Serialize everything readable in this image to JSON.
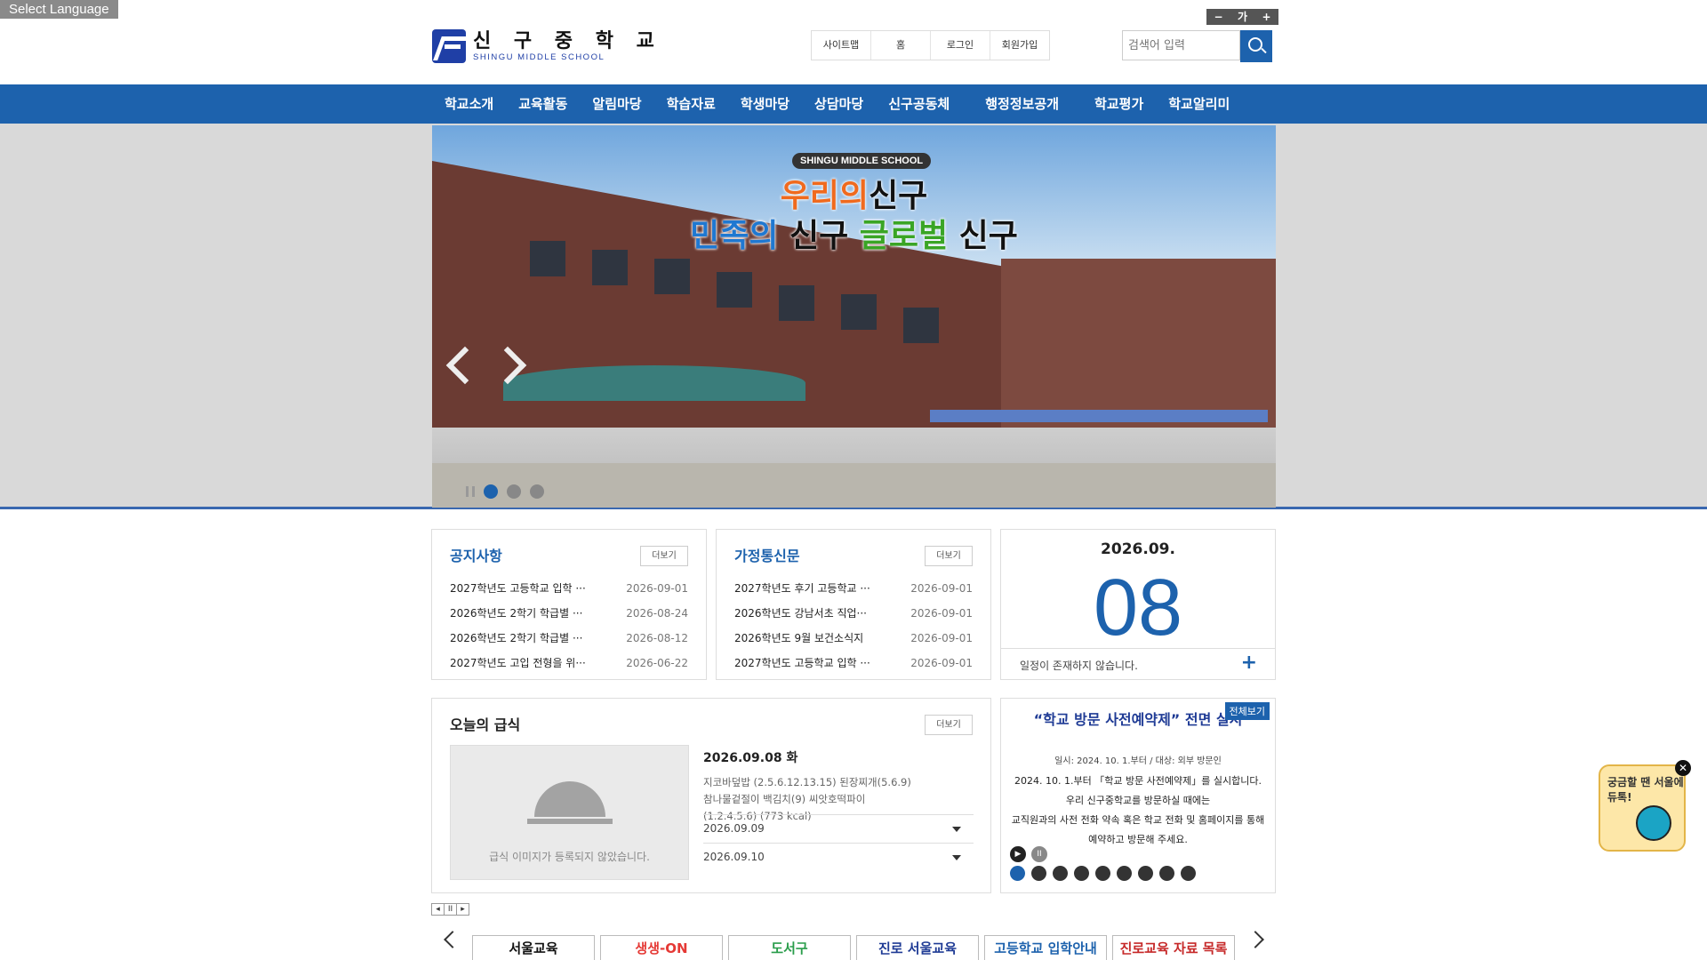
{
  "language_selector": "Select Language",
  "logo": {
    "name_ko": "신 구 중 학 교",
    "name_en": "SHINGU MIDDLE SCHOOL"
  },
  "util_links": [
    "사이트맵",
    "홈",
    "로그인",
    "회원가입"
  ],
  "font_controls": [
    "−",
    "가",
    "+"
  ],
  "search": {
    "placeholder": "검색어 입력"
  },
  "nav": [
    "학교소개",
    "교육활동",
    "알림마당",
    "학습자료",
    "학생마당",
    "상담마당",
    "신구공동체",
    "행정정보공개",
    "학교평가",
    "학교알리미"
  ],
  "banner": {
    "tag": "SHINGU MIDDLE SCHOOL",
    "line1_a": "우리의",
    "line1_b": "신구",
    "line2_a": "민족의",
    "line2_b": " 신구 ",
    "line2_c": "글로벌",
    "line2_d": " 신구",
    "active_slide": 1
  },
  "notice": {
    "title": "공지사항",
    "more": "더보기",
    "items": [
      {
        "title": "2027학년도 고등학교 입학 ···",
        "date": "2026-09-01"
      },
      {
        "title": "2026학년도 2학기 학급별 ···",
        "date": "2026-08-24"
      },
      {
        "title": "2026학년도 2학기 학급별 ···",
        "date": "2026-08-12"
      },
      {
        "title": "2027학년도 고입 전형을 위···",
        "date": "2026-06-22"
      }
    ]
  },
  "newsletter": {
    "title": "가정통신문",
    "more": "더보기",
    "items": [
      {
        "title": "2027학년도 후기 고등학교 ···",
        "date": "2026-09-01"
      },
      {
        "title": "2026학년도 강남서초 직업···",
        "date": "2026-09-01"
      },
      {
        "title": "2026학년도 9월 보건소식지",
        "date": "2026-09-01"
      },
      {
        "title": "2027학년도 고등학교 입학 ···",
        "date": "2026-09-01"
      }
    ]
  },
  "calendar": {
    "month": "2026.09.",
    "day": "08",
    "message": "일정이 존재하지 않습니다.",
    "plus": "+"
  },
  "meal": {
    "title": "오늘의 급식",
    "more": "더보기",
    "image_msg": "급식 이미지가 등록되지 않았습니다.",
    "date": "2026.09.08 화",
    "menu": "지코바덮밥 (2.5.6.12.13.15) 된장찌개(5.6.9) 참나물겉절이 백김치(9) 씨앗호떡파이(1.2.4.5.6) (773 kcal)",
    "next_dates": [
      "2026.09.09",
      "2026.09.10"
    ]
  },
  "popup": {
    "title": "“학교 방문 사전예약제” 전면 실시",
    "view_all": "전체보기",
    "sub": "일시: 2024. 10. 1.부터 / 대상: 외부 방문인",
    "lines": [
      "2024. 10. 1.부터 「학교 방문 사전예약제」를 실시합니다.",
      "우리 신구중학교를 방문하실 때에는",
      "교직원과의 사전 전화 약속 혹은 학교 전화 및 홈페이지를 통해",
      "예약하고 방문해 주세요."
    ],
    "active_dot": 0,
    "dots": 9
  },
  "tiny_controls": [
    "◂",
    "II",
    "▸"
  ],
  "link_banners": [
    "서울교육",
    "생생-ON",
    "도서구",
    "진로 서울교육",
    "고등학교 입학안내",
    "진로교육 자료 목록"
  ],
  "float_widget": {
    "text": "궁금할 땐 서울에듀톡!",
    "close": "✕"
  }
}
